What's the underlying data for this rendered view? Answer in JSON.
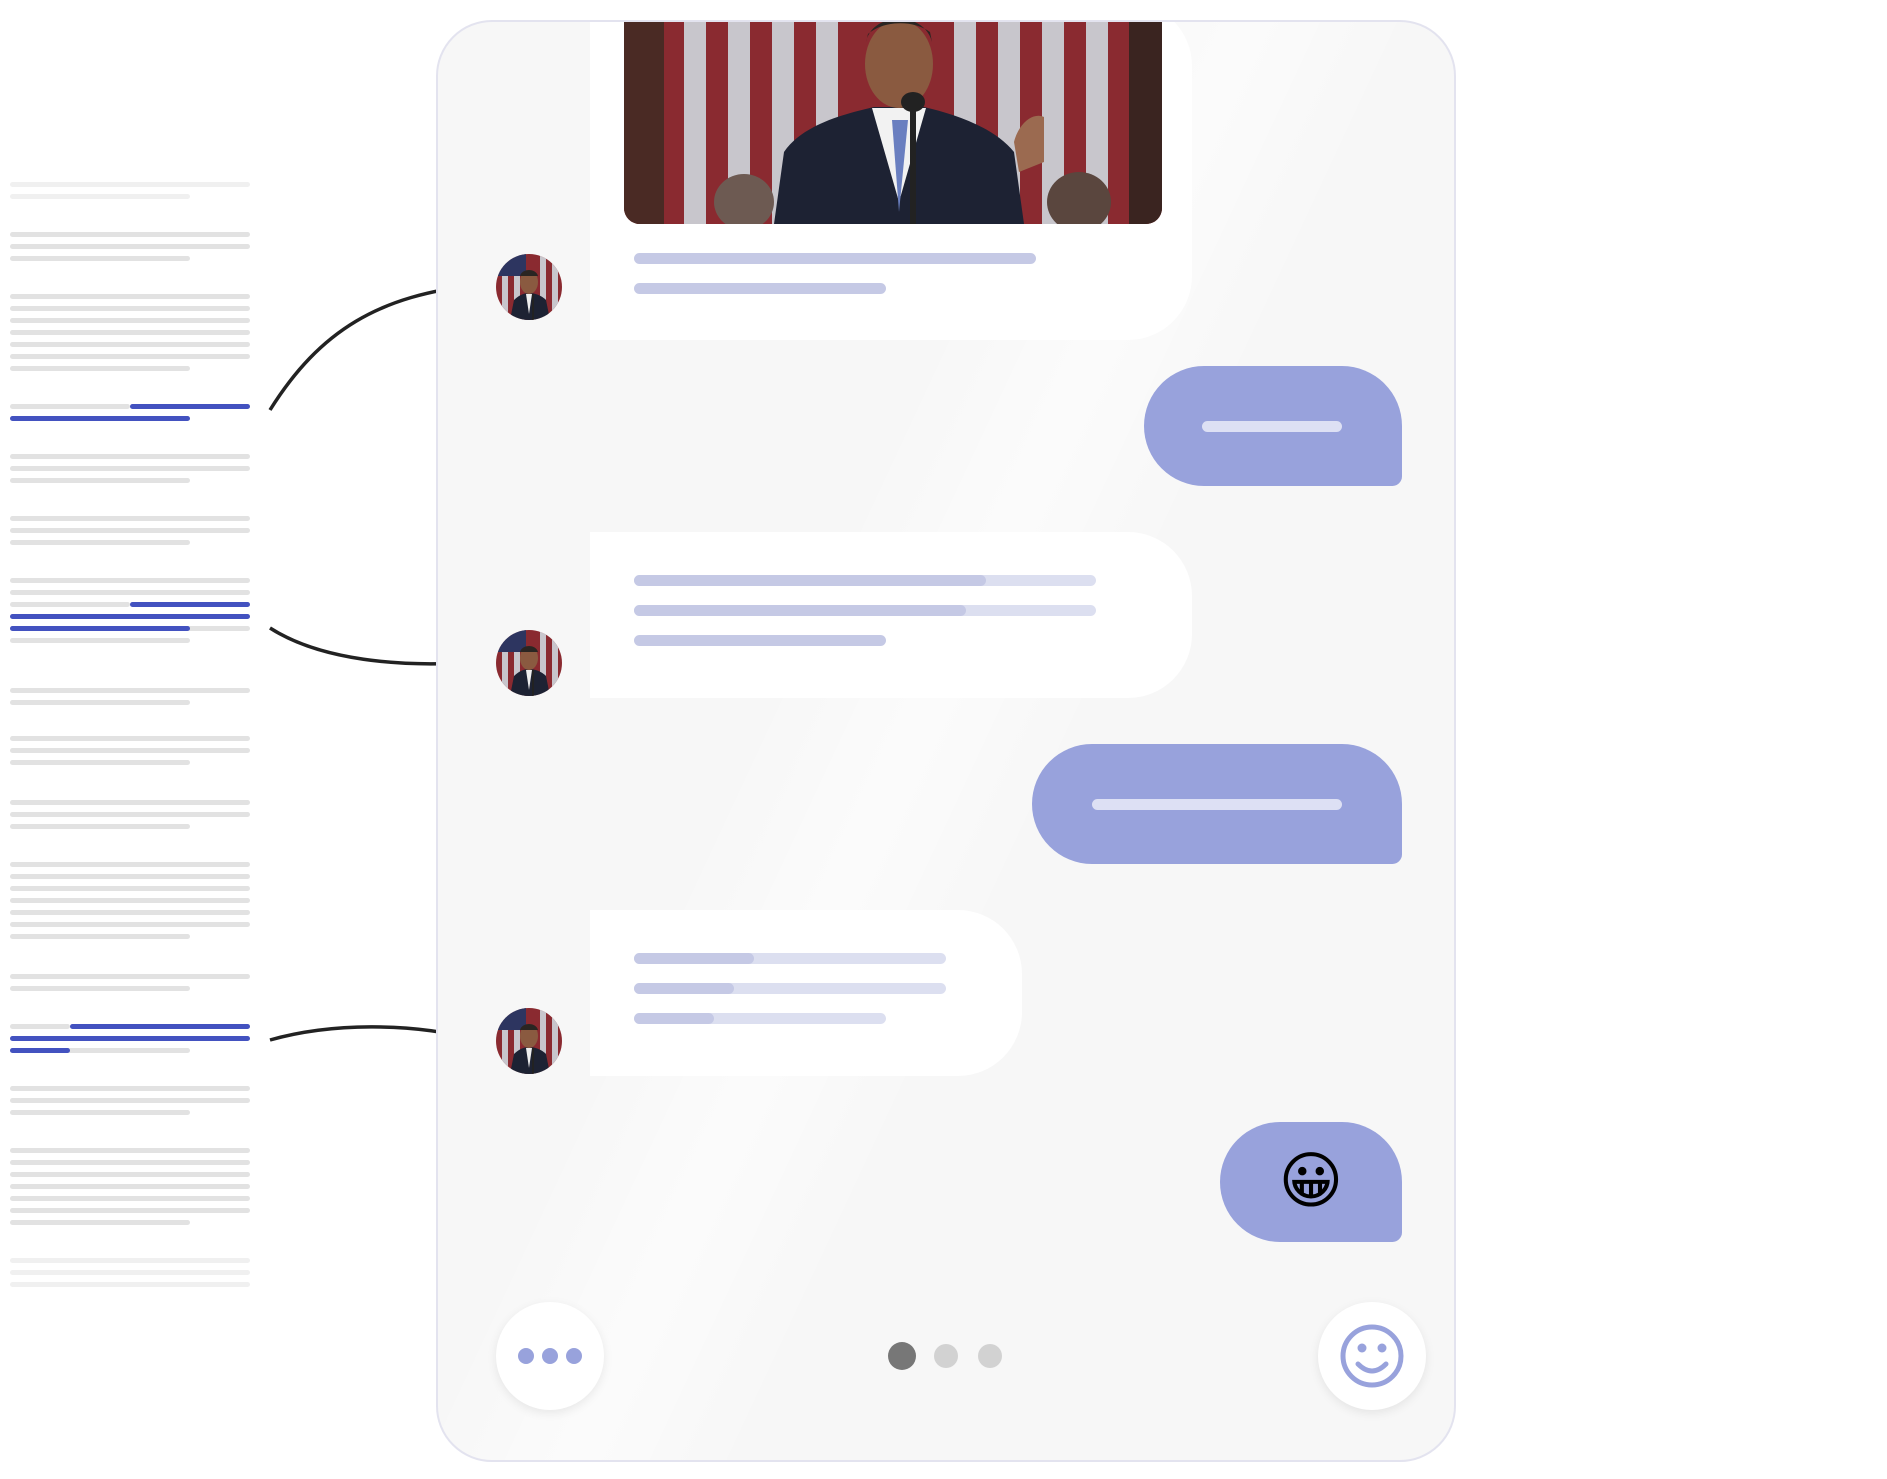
{
  "colors": {
    "accent": "#98a2dc",
    "highlight": "#4352c0",
    "placeholder": "#e2e2e2",
    "arrow": "#222222"
  },
  "document": {
    "description_icon": "document-text-lines"
  },
  "chat": {
    "messages": [
      {
        "side": "incoming",
        "has_image": true,
        "image_icon": "speaker-at-podium-photo",
        "avatar_icon": "speaker-avatar"
      },
      {
        "side": "outgoing"
      },
      {
        "side": "incoming",
        "avatar_icon": "speaker-avatar"
      },
      {
        "side": "outgoing"
      },
      {
        "side": "incoming",
        "avatar_icon": "speaker-avatar"
      },
      {
        "side": "outgoing",
        "content": "😀"
      }
    ],
    "footer": {
      "more_icon": "ellipsis-icon",
      "emoji_icon": "smiley-icon",
      "pager": {
        "count": 3,
        "active": 1
      }
    }
  }
}
